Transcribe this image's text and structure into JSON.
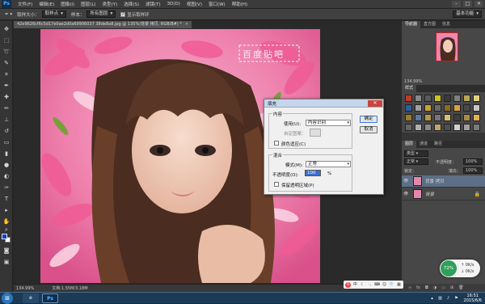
{
  "app": {
    "logo": "Ps"
  },
  "menu": [
    "文件(F)",
    "编辑(E)",
    "图像(I)",
    "图层(L)",
    "类型(Y)",
    "选择(S)",
    "滤镜(T)",
    "3D(D)",
    "视图(V)",
    "窗口(W)",
    "帮助(H)"
  ],
  "window_controls": [
    "–",
    "□",
    "✕"
  ],
  "options_bar": {
    "sample_size_label": "取样大小：",
    "sample_size_value": "取样点",
    "sample_label": "样本：",
    "sample_value": "所有图层",
    "show_ring_label": "显示取样环",
    "workspace": "基本功能"
  },
  "document": {
    "tab_title": "42e9626cf6c5d17e0ae2d0a69906037 38de8a8.jpg @ 135%(背景 拷贝, RGB/8#) *",
    "tab_close": "×",
    "zoom": "134.99%",
    "doc_size": "文档:1.55M/3.18M"
  },
  "watermark": "百度贴吧",
  "fill_dialog": {
    "title": "填充",
    "close": "✕",
    "contents_legend": "内容",
    "use_label": "使用(U):",
    "use_value": "内容识别",
    "custom_pattern_label": "自定图案：",
    "color_adapt_label": "颜色适应(C)",
    "blending_legend": "混合",
    "mode_label": "模式(M):",
    "mode_value": "正常",
    "opacity_label": "不透明度(O):",
    "opacity_value": "100",
    "opacity_unit": "%",
    "preserve_transparency_label": "保留透明区域(P)",
    "ok_label": "确定",
    "cancel_label": "取消"
  },
  "navigator": {
    "tabs": [
      "导航器",
      "直方图",
      "信息"
    ],
    "zoom": "134.99%"
  },
  "styles": {
    "tabs": [
      "样式"
    ],
    "swatches": [
      "#c0392b",
      "#888888",
      "#5a5a5a",
      "#ccc12a",
      "#3a3a3a",
      "#7f7f7f",
      "#b7a55a",
      "#e0d27a",
      "#2f5f9f",
      "#a0a0a0",
      "#caa230",
      "#6b6b6b",
      "#8c6b2a",
      "#d8a040",
      "#4a4a4a",
      "#c7c7c7",
      "#9a7a30",
      "#5a7aa0",
      "#b59a40",
      "#777777",
      "#d6c070",
      "#3e3e3e",
      "#a88a4a",
      "#e5b050",
      "#666666",
      "#b0b0b0",
      "#8a8a8a",
      "#c2a36a",
      "#4f4f4f",
      "#d0d0d0",
      "#9f9f9f",
      "#7a7a7a"
    ]
  },
  "layers": {
    "tabs": [
      "图层",
      "通道",
      "路径"
    ],
    "kind_label": "类型",
    "blend_mode": "正常",
    "opacity_label": "不透明度：",
    "opacity_value": "100%",
    "lock_label": "锁定：",
    "fill_label": "填充：",
    "fill_value": "100%",
    "items": [
      {
        "name": "背景 拷贝",
        "selected": true
      },
      {
        "name": "背景",
        "selected": false
      }
    ]
  },
  "perf_widget": {
    "percent": "72%",
    "upload": "0K/s",
    "download": "0K/s"
  },
  "clock": {
    "time": "16:51",
    "date": "2015/6/6"
  }
}
